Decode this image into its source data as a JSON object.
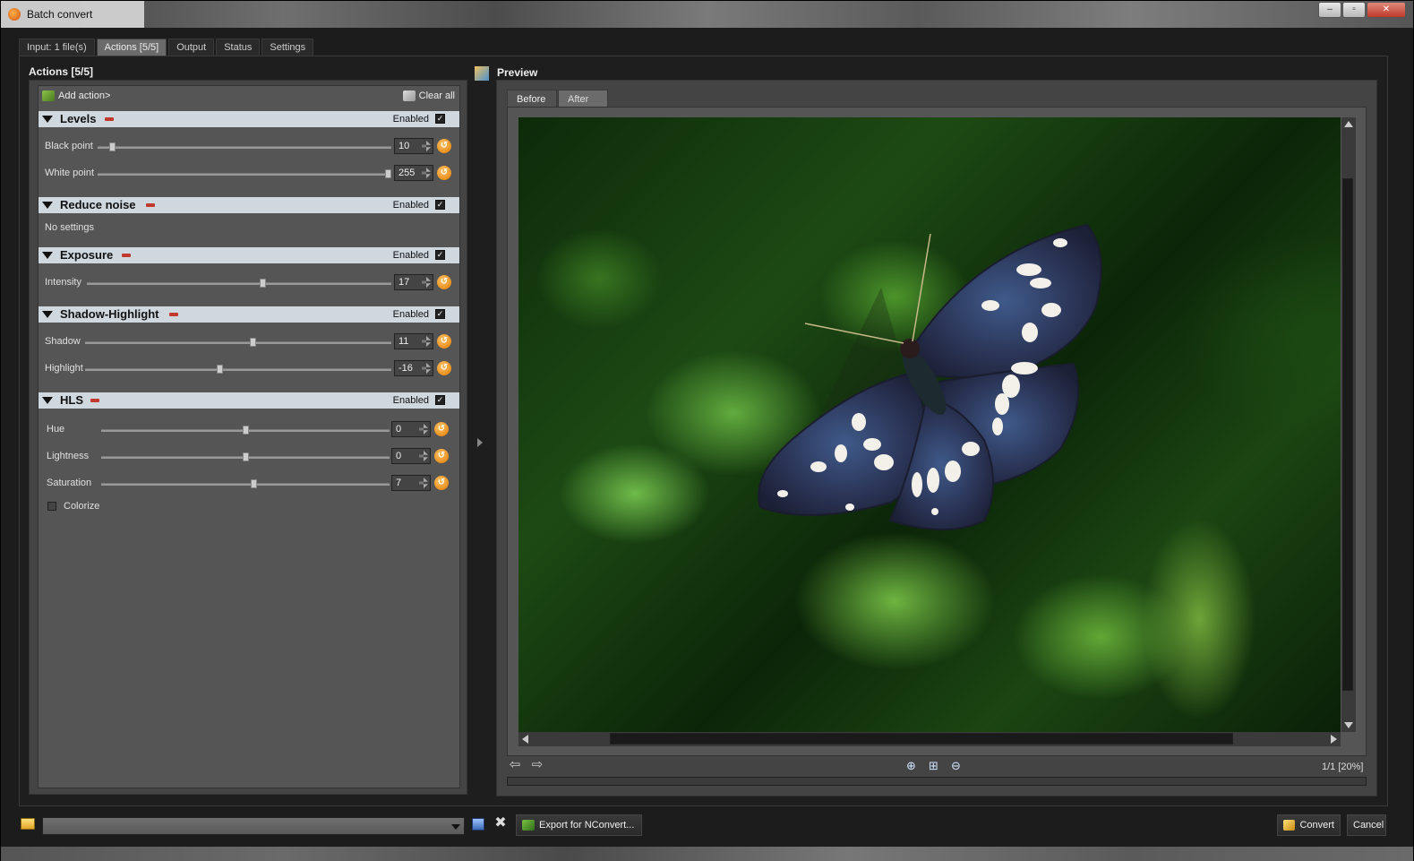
{
  "window": {
    "title": "Batch convert",
    "buttons": [
      "–",
      "▫",
      "✕"
    ]
  },
  "main_tabs": [
    {
      "label": "Input: 1 file(s)",
      "active": false
    },
    {
      "label": "Actions [5/5]",
      "active": true
    },
    {
      "label": "Output",
      "active": false
    },
    {
      "label": "Status",
      "active": false
    },
    {
      "label": "Settings",
      "active": false
    }
  ],
  "actions_panel": {
    "title": "Actions [5/5]",
    "add_action": "Add action>",
    "clear_all": "Clear all",
    "sections": [
      {
        "name": "Levels",
        "enabled_label": "Enabled",
        "enabled": true,
        "rows": [
          {
            "label": "Black point",
            "value": "10",
            "fraction": 0.04
          },
          {
            "label": "White point",
            "value": "255",
            "fraction": 1.0
          }
        ]
      },
      {
        "name": "Reduce noise",
        "enabled_label": "Enabled",
        "enabled": true,
        "note": "No settings"
      },
      {
        "name": "Exposure",
        "enabled_label": "Enabled",
        "enabled": true,
        "rows": [
          {
            "label": "Intensity",
            "value": "17",
            "fraction": 0.58
          }
        ]
      },
      {
        "name": "Shadow-Highlight",
        "enabled_label": "Enabled",
        "enabled": true,
        "rows": [
          {
            "label": "Shadow",
            "value": "11",
            "fraction": 0.55
          },
          {
            "label": "Highlight",
            "value": "-16",
            "fraction": 0.44
          }
        ]
      },
      {
        "name": "HLS",
        "enabled_label": "Enabled",
        "enabled": true,
        "rows": [
          {
            "label": "Hue",
            "value": "0",
            "fraction": 0.5
          },
          {
            "label": "Lightness",
            "value": "0",
            "fraction": 0.5
          },
          {
            "label": "Saturation",
            "value": "7",
            "fraction": 0.53
          }
        ],
        "colorize_label": "Colorize",
        "colorize": false
      }
    ]
  },
  "preview": {
    "title": "Preview",
    "tabs": [
      {
        "label": "Before",
        "active": true
      },
      {
        "label": "After",
        "active": false
      }
    ],
    "page_info": "1/1 [20%]",
    "icons": [
      "prev-arrow-icon",
      "next-arrow-icon",
      "zoom-in-icon",
      "fit-icon",
      "zoom-out-icon"
    ]
  },
  "bottom": {
    "preset_value": "",
    "export_label": "Export for NConvert...",
    "convert_label": "Convert",
    "cancel_label": "Cancel"
  },
  "colors": {
    "section_header": "#cfd7df",
    "reset_orange": "#e07b00",
    "panel_bg": "#555555"
  }
}
